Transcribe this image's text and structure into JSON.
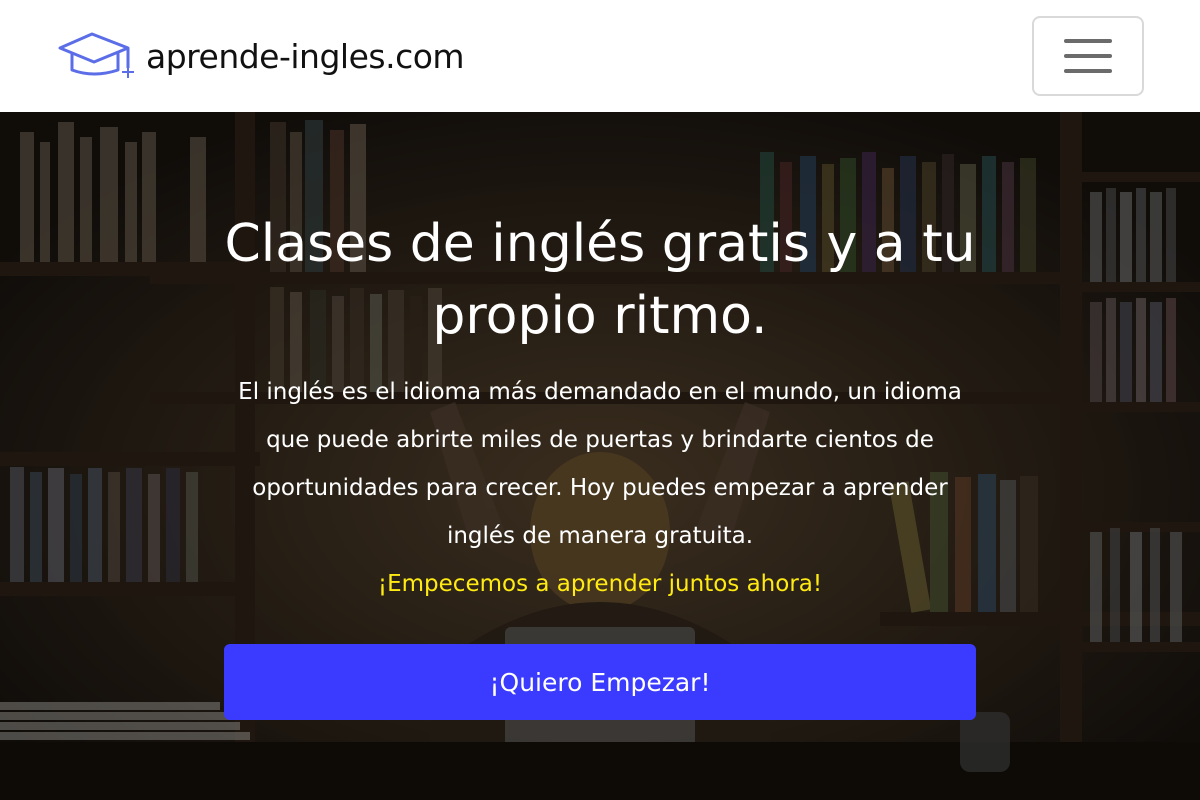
{
  "header": {
    "site_name": "aprende-ingles.com",
    "logo_icon": "graduation-cap-icon",
    "menu_icon": "hamburger-menu-icon",
    "brand_color": "#5b6ee8"
  },
  "hero": {
    "title": "Clases de inglés gratis y a tu propio ritmo.",
    "description": "El inglés es el idioma más demandado en el mundo, un idioma que puede abrirte miles de puertas y brindarte cientos de oportunidades para crecer. Hoy puedes empezar a aprender inglés de manera gratuita.",
    "highlight": "¡Empecemos a aprender juntos ahora!",
    "highlight_color": "#ffeb12",
    "cta_label": "¡Quiero Empezar!",
    "cta_color": "#3b3bff"
  }
}
